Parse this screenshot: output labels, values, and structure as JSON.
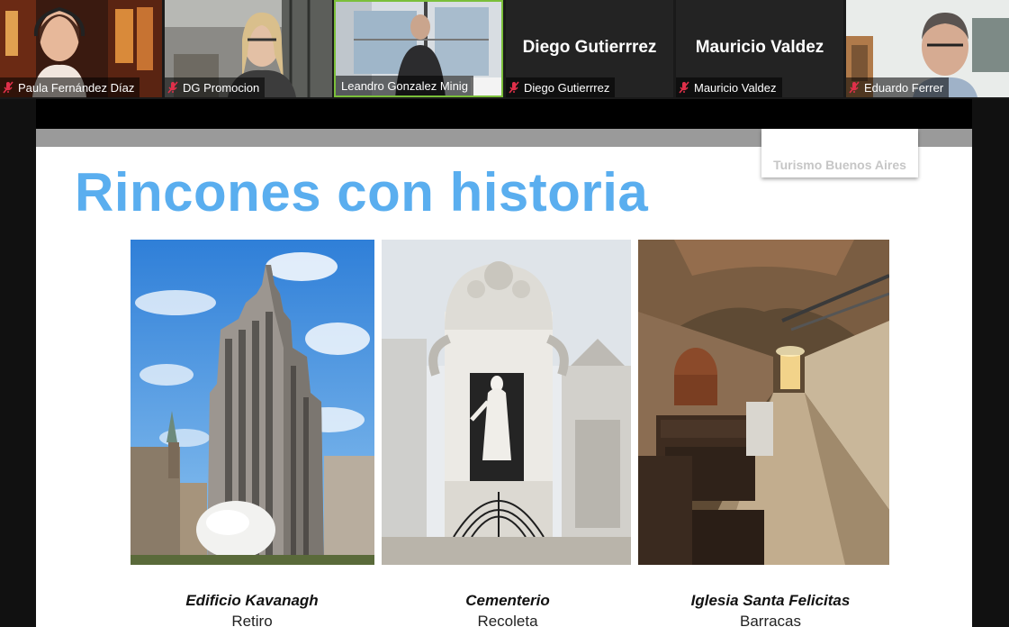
{
  "participants": [
    {
      "name": "Paula Fernández Díaz",
      "video": true
    },
    {
      "name": "DG Promocion",
      "video": true
    },
    {
      "name": "Leandro Gonzalez Minig",
      "video": true,
      "active_speaker": true
    },
    {
      "name": "Diego Gutierrrez",
      "video": false,
      "display_name": "Diego Gutierrrez"
    },
    {
      "name": "Mauricio Valdez",
      "video": false,
      "display_name": "Mauricio Valdez"
    },
    {
      "name": "Eduardo Ferrer",
      "video": true
    }
  ],
  "slide": {
    "brand": "Turismo Buenos Aires",
    "title": "Rincones con historia",
    "items": [
      {
        "title": "Edificio Kavanagh",
        "subtitle": "Retiro"
      },
      {
        "title": "Cementerio",
        "subtitle": "Recoleta"
      },
      {
        "title": "Iglesia Santa Felicitas",
        "subtitle": "Barracas"
      }
    ]
  },
  "colors": {
    "title_blue": "#5aaeef",
    "active_border": "#7bbf3a",
    "muted_red": "#e0304a"
  },
  "icons": {
    "muted": "microphone-muted-icon"
  }
}
